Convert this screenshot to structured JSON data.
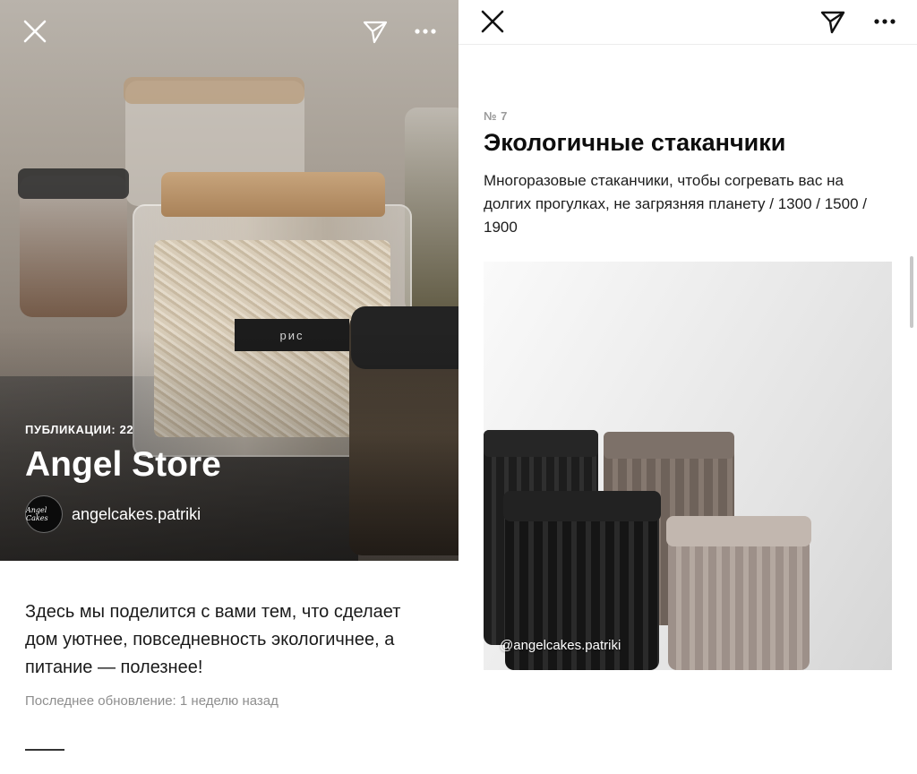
{
  "left_panel": {
    "hero": {
      "jar_label": "рис",
      "publications_label": "ПУБЛИКАЦИИ: 22",
      "title": "Angel Store",
      "author": {
        "avatar_text": "Angel Cakes",
        "username": "angelcakes.patriki"
      }
    },
    "description": "Здесь мы поделится с вами тем, что сделает дом уютнее, повседневность экологичнее, а питание  — полезнее!",
    "updated": "Последнее обновление: 1 неделю назад",
    "icons": {
      "close": "close-icon",
      "send": "send-icon",
      "more": "more-icon"
    }
  },
  "right_panel": {
    "item": {
      "number": "№ 7",
      "title": "Экологичные стаканчики",
      "description": "Многоразовые стаканчики, чтобы согревать вас на долгих прогулках, не загрязняя планету / 1300 / 1500 / 1900",
      "photo_credit": "@angelcakes.patriki"
    },
    "icons": {
      "close": "close-icon",
      "send": "send-icon",
      "more": "more-icon"
    }
  },
  "colors": {
    "text_primary": "#111111",
    "text_muted": "#8e8e8e",
    "background": "#ffffff"
  }
}
